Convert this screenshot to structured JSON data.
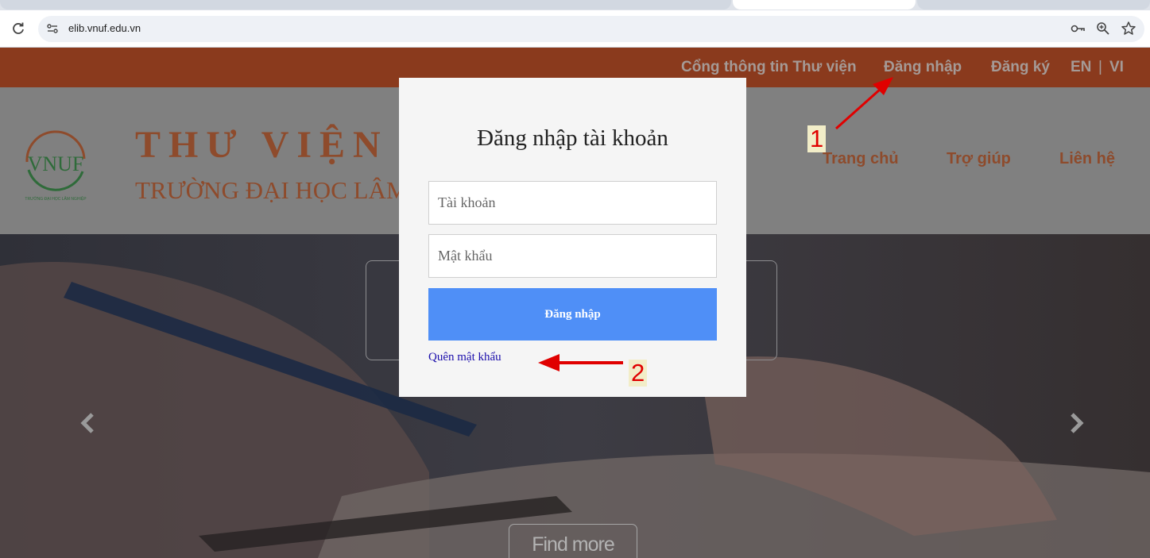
{
  "browser": {
    "url": "elib.vnuf.edu.vn",
    "reload_icon": "reload-icon",
    "password_icon": "key-icon",
    "zoom_icon": "zoom-icon",
    "bookmark_icon": "star-icon"
  },
  "topbar": {
    "portal": "Cổng thông tin Thư viện",
    "login": "Đăng nhập",
    "register": "Đăng ký",
    "lang_en": "EN",
    "lang_sep": "|",
    "lang_vi": "VI"
  },
  "header": {
    "logo_text": "VNUF",
    "logo_caption": "TRƯỜNG ĐẠI HỌC LÂM NGHIỆP",
    "title": "THƯ VIỆN S",
    "subtitle": "TRƯỜNG ĐẠI HỌC LÂM",
    "nav": {
      "home": "Trang chủ",
      "help": "Trợ giúp",
      "contact": "Liên hệ"
    }
  },
  "hero": {
    "find_more": "Find more",
    "prev_icon": "chevron-left-icon",
    "next_icon": "chevron-right-icon"
  },
  "modal": {
    "title": "Đăng nhập tài khoản",
    "username_placeholder": "Tài khoản",
    "password_placeholder": "Mật khẩu",
    "submit": "Đăng nhập",
    "forgot": "Quên mật khẩu"
  },
  "annotations": {
    "step1": "1",
    "step2": "2"
  },
  "colors": {
    "topbar": "#8a3a1d",
    "brand_text": "#8e4b2c",
    "button": "#4f8ff7",
    "annotation": "#e00000"
  }
}
